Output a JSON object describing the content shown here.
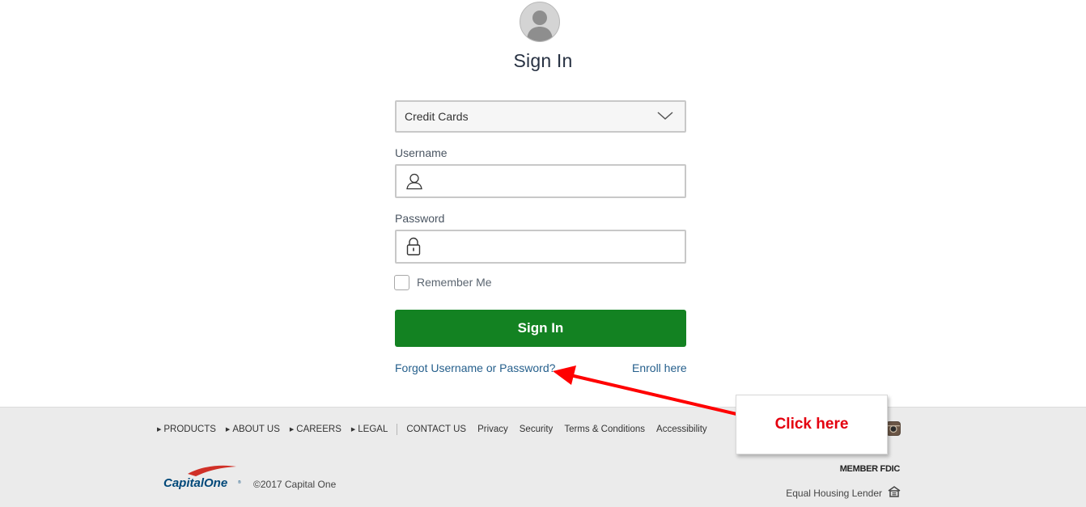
{
  "login": {
    "title": "Sign In",
    "account_type": "Credit Cards",
    "username_label": "Username",
    "password_label": "Password",
    "remember_label": "Remember Me",
    "signin_button": "Sign In",
    "forgot_link": "Forgot Username or Password?",
    "enroll_link": "Enroll here",
    "button_color": "#138222",
    "link_color": "#255f8c"
  },
  "footer": {
    "nav": [
      {
        "label": "PRODUCTS"
      },
      {
        "label": "ABOUT US"
      },
      {
        "label": "CAREERS"
      },
      {
        "label": "LEGAL"
      }
    ],
    "links": [
      "CONTACT US",
      "Privacy",
      "Security",
      "Terms & Conditions",
      "Accessibility"
    ],
    "logo_text": "CapitalOne",
    "copyright": "©2017 Capital One",
    "fdic": "MEMBER FDIC",
    "equal_housing": "Equal Housing Lender"
  },
  "annotation": {
    "callout_text": "Click here",
    "color": "#e4000f"
  },
  "icons": [
    "avatar-icon",
    "chevron-down-icon",
    "user-icon",
    "lock-icon",
    "instagram-icon",
    "equal-housing-icon"
  ]
}
